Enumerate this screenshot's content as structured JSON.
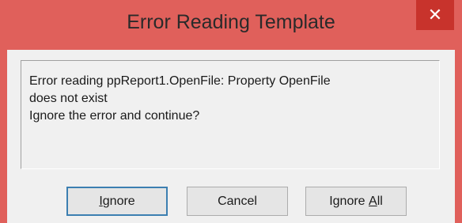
{
  "window": {
    "title": "Error Reading Template",
    "close_glyph": "✕"
  },
  "message": {
    "line1": "Error reading ppReport1.OpenFile: Property OpenFile",
    "line2": "does not exist",
    "line3": "Ignore the error and continue?"
  },
  "buttons": {
    "ignore": {
      "accel": "I",
      "rest": "gnore"
    },
    "cancel": {
      "label": "Cancel"
    },
    "ignore_all": {
      "prefix": "Ignore ",
      "accel": "A",
      "rest": "ll"
    }
  },
  "colors": {
    "titlebar": "#e0605b",
    "close_button": "#c8332c",
    "dialog_background": "#f0f0f0",
    "default_button_border": "#3c7fb1"
  }
}
